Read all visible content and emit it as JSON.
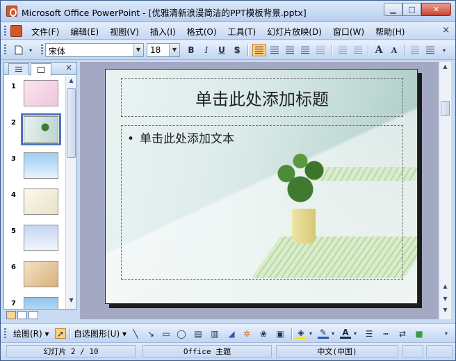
{
  "window": {
    "title": "Microsoft Office PowerPoint - [优雅清新浪漫简洁的PPT模板背景.pptx]",
    "minimize": "▁",
    "maximize": "□",
    "close": "✕"
  },
  "menu": {
    "items": [
      "文件(F)",
      "编辑(E)",
      "视图(V)",
      "插入(I)",
      "格式(O)",
      "工具(T)",
      "幻灯片放映(D)",
      "窗口(W)",
      "帮助(H)"
    ],
    "close": "×"
  },
  "format_toolbar": {
    "font": "宋体",
    "size": "18",
    "bold": "B",
    "italic": "I",
    "underline": "U",
    "shadow": "S",
    "grow": "A",
    "shrink": "A"
  },
  "left_panel": {
    "close": "×",
    "slides": [
      {
        "num": "1",
        "bg": "#f6d6e6"
      },
      {
        "num": "2",
        "bg": "#cfe2dc"
      },
      {
        "num": "3",
        "bg": "#bfe0f7"
      },
      {
        "num": "4",
        "bg": "#f4f1df"
      },
      {
        "num": "5",
        "bg": "#dfe8f7"
      },
      {
        "num": "6",
        "bg": "#f2d9b8"
      },
      {
        "num": "7",
        "bg": "#bcdcf4"
      }
    ]
  },
  "slide": {
    "title": "单击此处添加标题",
    "body": "单击此处添加文本",
    "bullet": "•"
  },
  "draw_toolbar": {
    "draw": "绘图(R)",
    "autoshapes": "自选图形(U)"
  },
  "status": {
    "slide": "幻灯片 2 / 10",
    "theme": "Office 主题",
    "language": "中文(中国)"
  }
}
